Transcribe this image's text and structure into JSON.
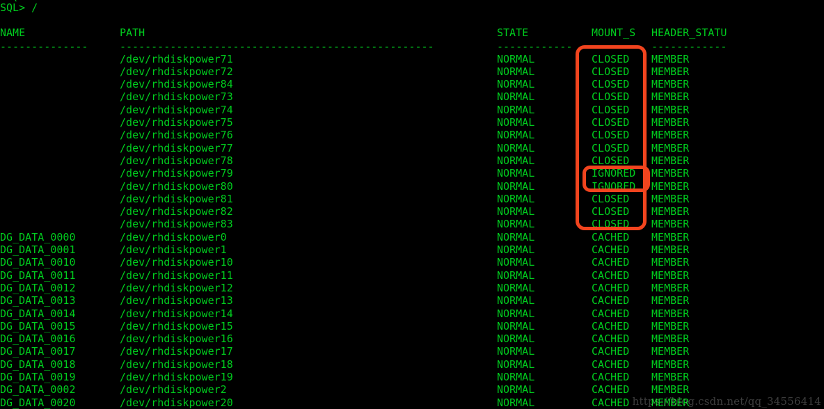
{
  "terminal": {
    "background_color": "#000000",
    "foreground_color": "#00cc1e",
    "annotation_color": "#f2441e",
    "prompt_line": "SQL> /",
    "artifact_line": "  \\     .        .     "
  },
  "columns": {
    "name": "NAME",
    "path": "PATH",
    "state": "STATE",
    "mount_s": "MOUNT_S",
    "header_statu": "HEADER_STATU",
    "dashes_name": "--------------",
    "dashes_path": "--------------------------------------------------",
    "dashes_state": "------------",
    "dashes_mount": "-------",
    "dashes_header": "------------"
  },
  "rows": [
    {
      "name": "",
      "path": "/dev/rhdiskpower71",
      "state": "NORMAL",
      "mount_s": "CLOSED",
      "header_statu": "MEMBER"
    },
    {
      "name": "",
      "path": "/dev/rhdiskpower72",
      "state": "NORMAL",
      "mount_s": "CLOSED",
      "header_statu": "MEMBER"
    },
    {
      "name": "",
      "path": "/dev/rhdiskpower84",
      "state": "NORMAL",
      "mount_s": "CLOSED",
      "header_statu": "MEMBER"
    },
    {
      "name": "",
      "path": "/dev/rhdiskpower73",
      "state": "NORMAL",
      "mount_s": "CLOSED",
      "header_statu": "MEMBER"
    },
    {
      "name": "",
      "path": "/dev/rhdiskpower74",
      "state": "NORMAL",
      "mount_s": "CLOSED",
      "header_statu": "MEMBER"
    },
    {
      "name": "",
      "path": "/dev/rhdiskpower75",
      "state": "NORMAL",
      "mount_s": "CLOSED",
      "header_statu": "MEMBER"
    },
    {
      "name": "",
      "path": "/dev/rhdiskpower76",
      "state": "NORMAL",
      "mount_s": "CLOSED",
      "header_statu": "MEMBER"
    },
    {
      "name": "",
      "path": "/dev/rhdiskpower77",
      "state": "NORMAL",
      "mount_s": "CLOSED",
      "header_statu": "MEMBER"
    },
    {
      "name": "",
      "path": "/dev/rhdiskpower78",
      "state": "NORMAL",
      "mount_s": "CLOSED",
      "header_statu": "MEMBER"
    },
    {
      "name": "",
      "path": "/dev/rhdiskpower79",
      "state": "NORMAL",
      "mount_s": "IGNORED",
      "header_statu": "MEMBER"
    },
    {
      "name": "",
      "path": "/dev/rhdiskpower80",
      "state": "NORMAL",
      "mount_s": "IGNORED",
      "header_statu": "MEMBER"
    },
    {
      "name": "",
      "path": "/dev/rhdiskpower81",
      "state": "NORMAL",
      "mount_s": "CLOSED",
      "header_statu": "MEMBER"
    },
    {
      "name": "",
      "path": "/dev/rhdiskpower82",
      "state": "NORMAL",
      "mount_s": "CLOSED",
      "header_statu": "MEMBER"
    },
    {
      "name": "",
      "path": "/dev/rhdiskpower83",
      "state": "NORMAL",
      "mount_s": "CLOSED",
      "header_statu": "MEMBER"
    },
    {
      "name": "DG_DATA_0000",
      "path": "/dev/rhdiskpower0",
      "state": "NORMAL",
      "mount_s": "CACHED",
      "header_statu": "MEMBER"
    },
    {
      "name": "DG_DATA_0001",
      "path": "/dev/rhdiskpower1",
      "state": "NORMAL",
      "mount_s": "CACHED",
      "header_statu": "MEMBER"
    },
    {
      "name": "DG_DATA_0010",
      "path": "/dev/rhdiskpower10",
      "state": "NORMAL",
      "mount_s": "CACHED",
      "header_statu": "MEMBER"
    },
    {
      "name": "DG_DATA_0011",
      "path": "/dev/rhdiskpower11",
      "state": "NORMAL",
      "mount_s": "CACHED",
      "header_statu": "MEMBER"
    },
    {
      "name": "DG_DATA_0012",
      "path": "/dev/rhdiskpower12",
      "state": "NORMAL",
      "mount_s": "CACHED",
      "header_statu": "MEMBER"
    },
    {
      "name": "DG_DATA_0013",
      "path": "/dev/rhdiskpower13",
      "state": "NORMAL",
      "mount_s": "CACHED",
      "header_statu": "MEMBER"
    },
    {
      "name": "DG_DATA_0014",
      "path": "/dev/rhdiskpower14",
      "state": "NORMAL",
      "mount_s": "CACHED",
      "header_statu": "MEMBER"
    },
    {
      "name": "DG_DATA_0015",
      "path": "/dev/rhdiskpower15",
      "state": "NORMAL",
      "mount_s": "CACHED",
      "header_statu": "MEMBER"
    },
    {
      "name": "DG_DATA_0016",
      "path": "/dev/rhdiskpower16",
      "state": "NORMAL",
      "mount_s": "CACHED",
      "header_statu": "MEMBER"
    },
    {
      "name": "DG_DATA_0017",
      "path": "/dev/rhdiskpower17",
      "state": "NORMAL",
      "mount_s": "CACHED",
      "header_statu": "MEMBER"
    },
    {
      "name": "DG_DATA_0018",
      "path": "/dev/rhdiskpower18",
      "state": "NORMAL",
      "mount_s": "CACHED",
      "header_statu": "MEMBER"
    },
    {
      "name": "DG_DATA_0019",
      "path": "/dev/rhdiskpower19",
      "state": "NORMAL",
      "mount_s": "CACHED",
      "header_statu": "MEMBER"
    },
    {
      "name": "DG_DATA_0002",
      "path": "/dev/rhdiskpower2",
      "state": "NORMAL",
      "mount_s": "CACHED",
      "header_statu": "MEMBER"
    },
    {
      "name": "DG_DATA_0020",
      "path": "/dev/rhdiskpower20",
      "state": "NORMAL",
      "mount_s": "CACHED",
      "header_statu": "MEMBER"
    }
  ],
  "annotations": [
    {
      "id": "outer",
      "label": "mount-status-highlight-outer"
    },
    {
      "id": "inner",
      "label": "ignored-rows-highlight-inner"
    }
  ],
  "watermark": {
    "text": "https://blog.csdn.net/qq_34556414"
  }
}
